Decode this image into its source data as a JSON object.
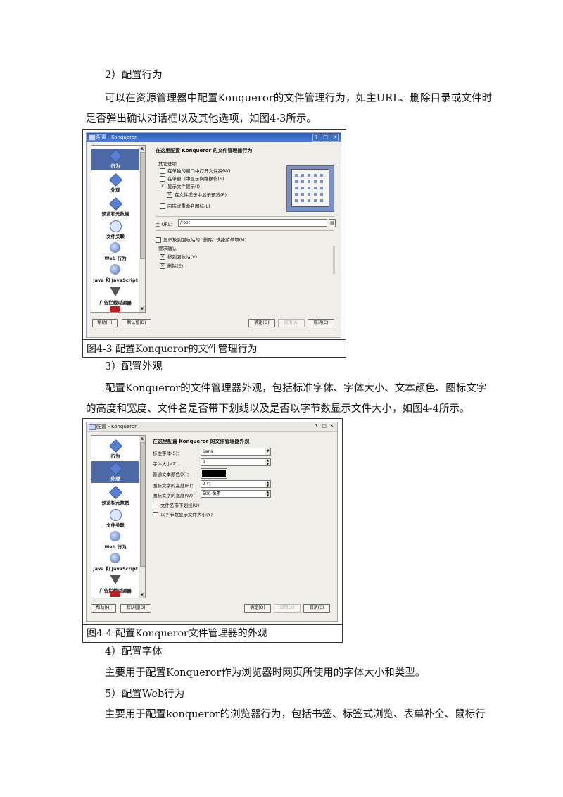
{
  "paragraphs": {
    "h2": "2）配置行为",
    "p2_line1": "可以在资源管理器中配置Konqueror的文件管理行为，如主URL、删除目录或文件时",
    "p2_line2": "是否弹出确认对话框以及其他选项，如图4-3所示。",
    "h3": "3）配置外观",
    "p3_line1": "配置Konqueror的文件管理器外观，包括标准字体、字体大小、文本颜色、图标文字",
    "p3_line2": "的高度和宽度、文件名是否带下划线以及是否以字节数显示文件大小，如图4-4所示。",
    "h4": "4）配置字体",
    "p4": "主要用于配置Konqueror作为浏览器时网页所使用的字体大小和类型。",
    "h5": "5）配置Web行为",
    "p5": "主要用于配置konqueror的浏览器行为，包括书签、标签式浏览、表单补全、鼠标行"
  },
  "figure1": {
    "caption": "图4-3  配置Konqueror的文件管理行为",
    "window_title": "配置 - Konqueror",
    "title_buttons": [
      "?",
      "□",
      "✕"
    ],
    "sidebar": [
      {
        "label": "行为",
        "icon": "cube-icon",
        "selected": true
      },
      {
        "label": "外观",
        "icon": "cube-icon",
        "selected": false
      },
      {
        "label": "预览和元数据",
        "icon": "cube-icon",
        "selected": false
      },
      {
        "label": "文件关联",
        "icon": "bubble-icon",
        "selected": false
      },
      {
        "label": "Web 行为",
        "icon": "globe-icon",
        "selected": false
      },
      {
        "label": "Java 和 JavaScript",
        "icon": "globe-icon",
        "selected": false
      },
      {
        "label": "广告拦截过滤器",
        "icon": "funnel-icon",
        "selected": false
      }
    ],
    "header": "在这里配置 Konqueror 的文件管理器行为",
    "group_other": "其它选项",
    "options": [
      {
        "label": "在单独的窗口中打开文件夹(W)",
        "checked": false
      },
      {
        "label": "在单窗口中显示网络操作(S)",
        "checked": false
      },
      {
        "label": "显示文件提示(I)",
        "checked": true
      },
      {
        "label": "在文件提示中显示预览(P)",
        "checked": true
      },
      {
        "label": "内嵌式重命名图标(L)",
        "checked": false
      }
    ],
    "home_url_label": "主 URL：",
    "home_url_value": "/root",
    "trash_menu": {
      "label": "显示放到回收站的 \"删除\" 快捷菜单项(M)",
      "checked": false
    },
    "confirm_group": "要求确认",
    "confirm_options": [
      {
        "label": "移到回收站(V)",
        "checked": true
      },
      {
        "label": "删除(E)",
        "checked": true
      }
    ],
    "buttons": {
      "help": "帮助(H)",
      "defaults": "默认值(D)",
      "ok": "确定(O)",
      "apply": "应用(A)",
      "cancel": "取消(C)"
    }
  },
  "figure2": {
    "caption": "图4-4  配置Konqueror文件管理器的外观",
    "window_title": "配置 - Konqueror",
    "title_buttons": [
      "?",
      "□",
      "✕"
    ],
    "sidebar": [
      {
        "label": "行为",
        "icon": "cube-icon",
        "selected": false
      },
      {
        "label": "外观",
        "icon": "cube-icon",
        "selected": true
      },
      {
        "label": "预览和元数据",
        "icon": "cube-icon",
        "selected": false
      },
      {
        "label": "文件关联",
        "icon": "bubble-icon",
        "selected": false
      },
      {
        "label": "Web 行为",
        "icon": "globe-icon",
        "selected": false
      },
      {
        "label": "Java 和 JavaScript",
        "icon": "globe-icon",
        "selected": false
      },
      {
        "label": "广告拦截过滤器",
        "icon": "funnel-icon",
        "selected": false
      }
    ],
    "header": "在这里配置 Konqueror 的文件管理器外观",
    "fields": {
      "std_font_label": "标准字体(S)：",
      "std_font_value": "Sans",
      "font_size_label": "字体大小(Z)：",
      "font_size_value": "9",
      "text_color_label": "普通文本颜色(X)：",
      "text_color_value": "#000000",
      "icon_text_height_label": "图标文字的高度(E)：",
      "icon_text_height_value": "2 行",
      "icon_text_width_label": "图标文字的宽度(W)：",
      "icon_text_width_value": "500 像素"
    },
    "options": [
      {
        "label": "文件名带下划线(U)",
        "checked": false
      },
      {
        "label": "以字节数显示文件大小(Y)",
        "checked": false
      }
    ],
    "buttons": {
      "help": "帮助(H)",
      "defaults": "默认值(D)",
      "ok": "确定(O)",
      "apply": "应用(A)",
      "cancel": "取消(C)"
    }
  }
}
